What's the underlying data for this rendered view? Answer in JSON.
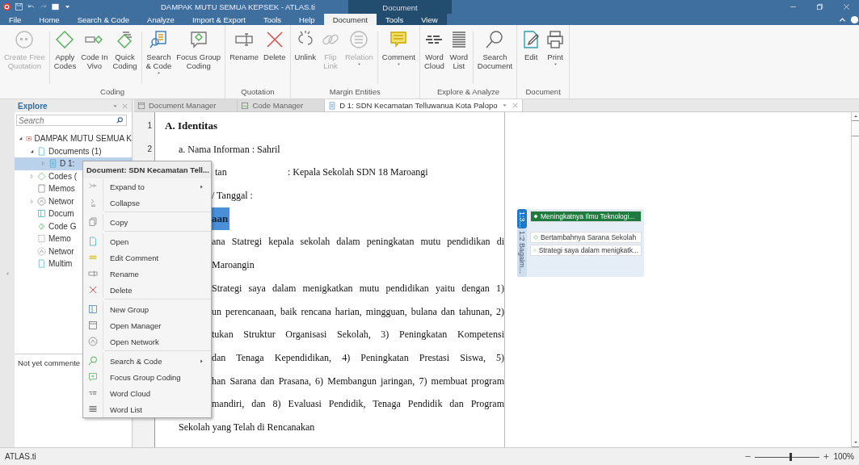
{
  "window": {
    "title": "DAMPAK MUTU SEMUA KEPSEK - ATLAS.ti",
    "context_label": "Document"
  },
  "menu_tabs": [
    {
      "label": "File",
      "selected": false,
      "contextual": false
    },
    {
      "label": "Home",
      "selected": false,
      "contextual": false
    },
    {
      "label": "Search & Code",
      "selected": false,
      "contextual": false
    },
    {
      "label": "Analyze",
      "selected": false,
      "contextual": false
    },
    {
      "label": "Import & Export",
      "selected": false,
      "contextual": false
    },
    {
      "label": "Tools",
      "selected": false,
      "contextual": false
    },
    {
      "label": "Help",
      "selected": false,
      "contextual": false
    },
    {
      "label": "Document",
      "selected": true,
      "contextual": true
    },
    {
      "label": "Tools",
      "selected": false,
      "contextual": true
    },
    {
      "label": "View",
      "selected": false,
      "contextual": true
    }
  ],
  "ribbon_groups": [
    {
      "label": "Coding",
      "sections": [
        [
          {
            "label": "Create Free\nQuotation",
            "disabled": true,
            "dropdown": false
          }
        ],
        [
          {
            "label": "Apply\nCodes",
            "disabled": false,
            "dropdown": false
          },
          {
            "label": "Code In\nVivo",
            "disabled": false,
            "dropdown": false
          },
          {
            "label": "Quick\nCoding",
            "disabled": false,
            "dropdown": false
          }
        ],
        [
          {
            "label": "Search\n& Code",
            "disabled": false,
            "dropdown": true
          },
          {
            "label": "Focus Group\nCoding",
            "disabled": false,
            "dropdown": false
          }
        ]
      ]
    },
    {
      "label": "Quotation",
      "sections": [
        [
          {
            "label": "Rename",
            "disabled": false,
            "dropdown": false
          },
          {
            "label": "Delete",
            "disabled": false,
            "dropdown": false
          }
        ]
      ]
    },
    {
      "label": "Margin Entities",
      "sections": [
        [
          {
            "label": "Unlink",
            "disabled": false,
            "dropdown": false
          },
          {
            "label": "Flip\nLink",
            "disabled": true,
            "dropdown": false
          },
          {
            "label": "Relation",
            "disabled": true,
            "dropdown": true
          }
        ],
        [
          {
            "label": "Comment",
            "disabled": false,
            "dropdown": true
          }
        ]
      ]
    },
    {
      "label": "Explore & Analyze",
      "sections": [
        [
          {
            "label": "Word\nCloud",
            "disabled": false,
            "dropdown": false
          },
          {
            "label": "Word\nList",
            "disabled": false,
            "dropdown": false
          }
        ],
        [
          {
            "label": "Search\nDocument",
            "disabled": false,
            "dropdown": false
          }
        ]
      ]
    },
    {
      "label": "Document",
      "sections": [
        [
          {
            "label": "Edit",
            "disabled": false,
            "dropdown": false
          },
          {
            "label": "Print",
            "disabled": false,
            "dropdown": true
          }
        ]
      ]
    }
  ],
  "explore": {
    "title": "Explore",
    "search": {
      "placeholder": "Search"
    },
    "tree": [
      {
        "label": "DAMPAK MUTU SEMUA K",
        "expanded": true,
        "selected": false,
        "children": [
          {
            "label": "Documents (1)",
            "expanded": true,
            "selected": false,
            "children": [
              {
                "label": "D 1:",
                "expanded": false,
                "selected": true
              }
            ]
          },
          {
            "label": "Codes (",
            "expanded": false,
            "selected": false
          },
          {
            "label": "Memos",
            "selected": false
          },
          {
            "label": "Networ",
            "expanded": false,
            "selected": false
          },
          {
            "label": "Docum",
            "selected": false
          },
          {
            "label": "Code G",
            "selected": false
          },
          {
            "label": "Memo",
            "selected": false
          },
          {
            "label": "Networ",
            "selected": false
          },
          {
            "label": "Multim",
            "selected": false
          }
        ]
      }
    ],
    "comment": "Not yet commente"
  },
  "doc_tabs": [
    {
      "label": "Document Manager",
      "selected": false
    },
    {
      "label": "Code Manager",
      "selected": false
    },
    {
      "label": "D 1: SDN Kecamatan Telluwanua Kota Palopo",
      "selected": true
    }
  ],
  "document": {
    "line_numbers": [
      "1",
      "2"
    ],
    "lines": [
      {
        "kind": "heading",
        "text": "A.  Identitas"
      },
      {
        "kind": "item",
        "text": "a.   Nama Informan : Sahril"
      },
      {
        "kind": "field",
        "text": "tan",
        "value": ": Kepala Sekolah SDN 18 Maroangi"
      },
      {
        "kind": "cut",
        "text": "/ Tanggal  :"
      },
      {
        "kind": "highlight",
        "text": "aan"
      },
      {
        "kind": "justified",
        "text": "ana Statregi kepala sekolah dalam peningkatan mutu pendidikan di"
      },
      {
        "kind": "cut",
        "text": "Maroangin"
      },
      {
        "kind": "justified",
        "text": "Strategi saya dalam menigkatkan mutu pendidikan yaitu dengan 1)"
      },
      {
        "kind": "justified",
        "text": "un perencanaan, baik rencana harian, mingguan, bulana dan tahunan, 2)"
      },
      {
        "kind": "justified",
        "text": "tukan Struktur Organisasi Sekolah, 3) Peningkatan Kompetensi"
      },
      {
        "kind": "justified",
        "text": "dan Tenaga Kependidikan, 4) Peningkatan Prestasi Siswa, 5)"
      },
      {
        "kind": "justified",
        "text": "han Sarana dan Prasana, 6) Membangun jaringan, 7) membuat program"
      },
      {
        "kind": "justified",
        "text": "mandiri,  dan 8) Evaluasi Pendidik, Tenaga Pendidik dan Program"
      },
      {
        "kind": "item",
        "text": "Sekolah yang Telah di Rencanakan"
      }
    ]
  },
  "margin": {
    "quotations": [
      {
        "label": "1:3...",
        "selected": true
      },
      {
        "label": "1:2 Bagaim...",
        "selected": false
      }
    ],
    "codes": [
      {
        "label": "Meningkatnya Ilmu Teknologi...",
        "selected": true
      },
      {
        "label": "Bertambahnya Sarana Sekolah",
        "selected": false
      },
      {
        "label": "Strategi saya dalam menigkatk...",
        "selected": false
      }
    ]
  },
  "context_menu": {
    "header": "Document: SDN Kecamatan Tell...",
    "sections": [
      [
        {
          "label": "Expand to",
          "submenu": true
        },
        {
          "label": "Collapse",
          "submenu": false
        }
      ],
      [
        {
          "label": "Copy",
          "submenu": false
        }
      ],
      [
        {
          "label": "Open",
          "submenu": false
        },
        {
          "label": "Edit Comment",
          "submenu": false
        },
        {
          "label": "Rename",
          "submenu": false
        },
        {
          "label": "Delete",
          "submenu": false
        }
      ],
      [
        {
          "label": "New Group",
          "submenu": false
        },
        {
          "label": "Open Manager",
          "submenu": false
        },
        {
          "label": "Open Network",
          "submenu": false
        }
      ],
      [
        {
          "label": "Search & Code",
          "submenu": true
        },
        {
          "label": "Focus Group Coding",
          "submenu": false
        },
        {
          "label": "Word Cloud",
          "submenu": false
        },
        {
          "label": "Word List",
          "submenu": false
        }
      ]
    ]
  },
  "status_bar": {
    "text": "ATLAS.ti",
    "zoom": {
      "level": 0.55,
      "reading": "100%"
    }
  }
}
